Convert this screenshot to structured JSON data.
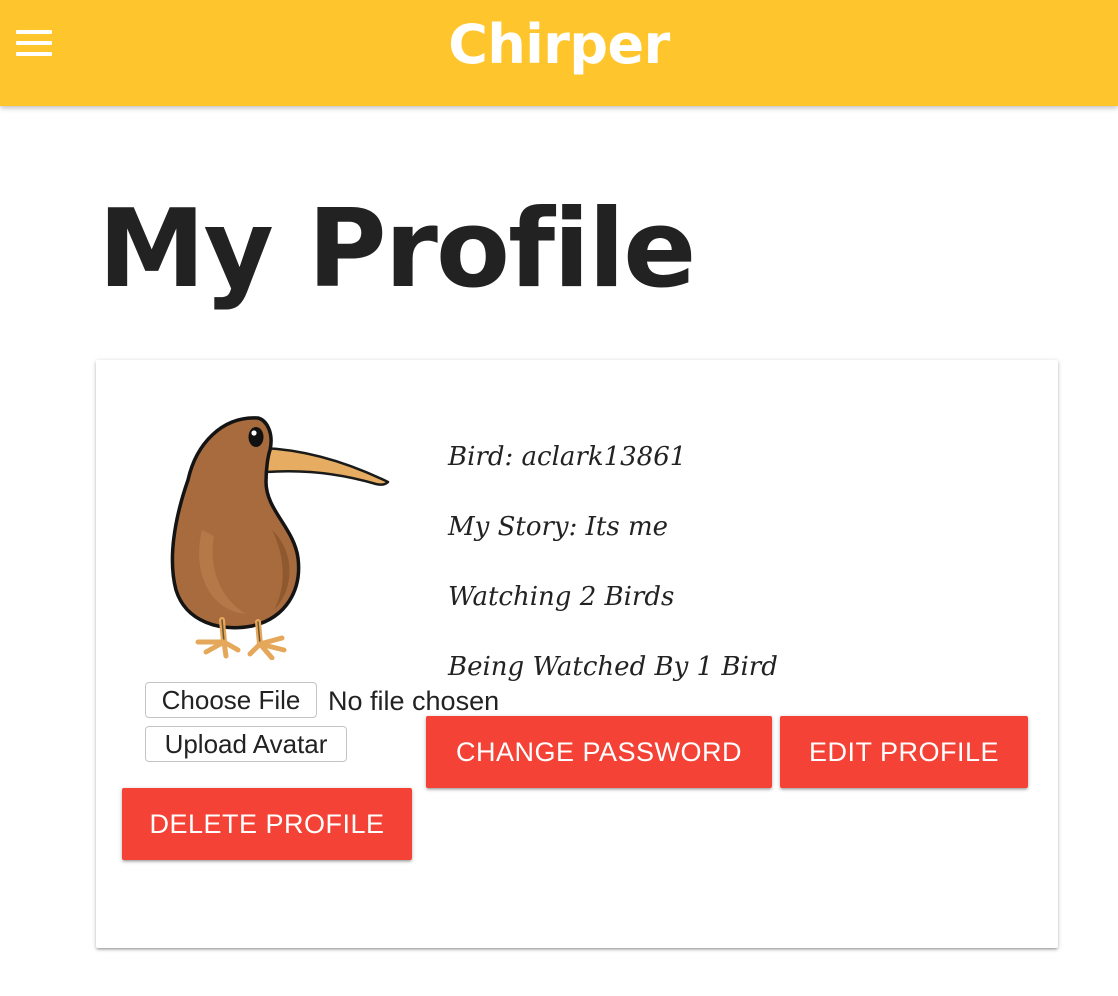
{
  "navbar": {
    "brand": "Chirper",
    "menu_icon": "hamburger-menu-icon",
    "background_color": "#ffc52c"
  },
  "page": {
    "title": "My Profile"
  },
  "profile": {
    "avatar_icon": "kiwi-bird-avatar",
    "bird_line": "Bird: aclark13861",
    "story_line": "My Story: Its me",
    "watching_line": "Watching 2 Birds",
    "watched_by_line": "Being Watched By 1 Bird"
  },
  "avatar_upload": {
    "choose_file_label": "Choose File",
    "file_status": "No file chosen",
    "upload_label": "Upload Avatar"
  },
  "actions": {
    "change_password_label": "CHANGE PASSWORD",
    "edit_profile_label": "EDIT PROFILE",
    "delete_profile_label": "DELETE PROFILE",
    "button_color": "#f44336"
  }
}
